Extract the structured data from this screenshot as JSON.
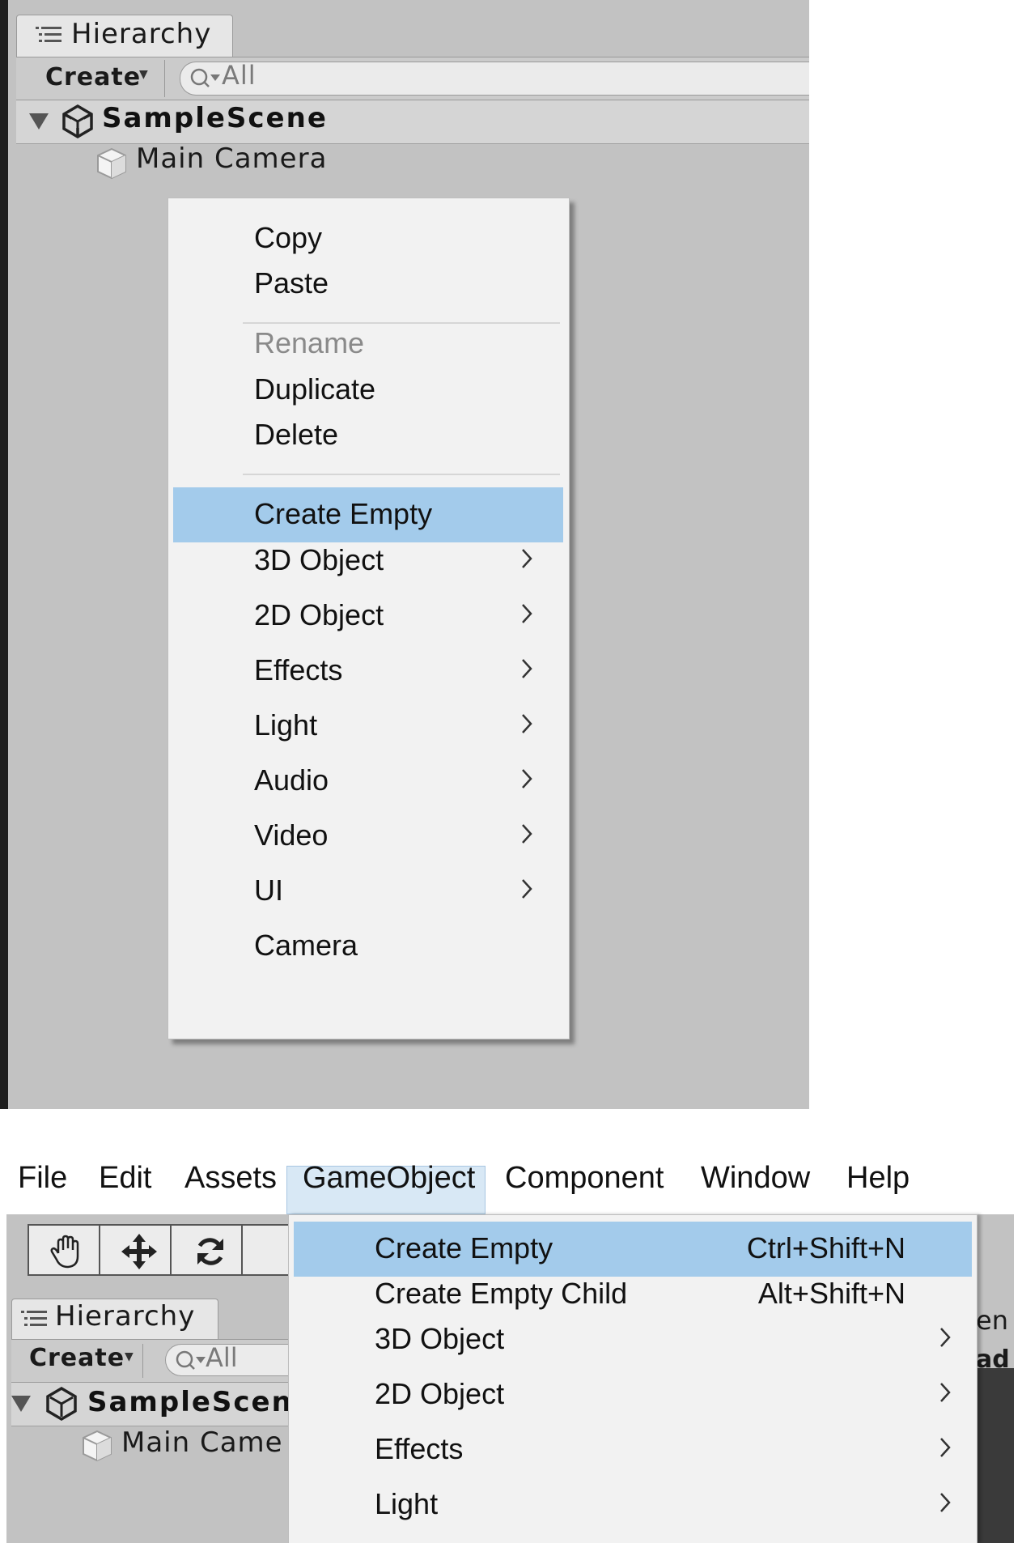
{
  "hierarchy_panel": {
    "tab_label": "Hierarchy",
    "create_label": "Create",
    "search_text": "All",
    "scene_name": "SampleScene",
    "camera_name": "Main Camera"
  },
  "context_menu": {
    "items": [
      {
        "label": "Copy"
      },
      {
        "label": "Paste"
      },
      {
        "label": "Rename",
        "disabled": true
      },
      {
        "label": "Duplicate"
      },
      {
        "label": "Delete"
      },
      {
        "label": "Create Empty",
        "highlighted": true
      },
      {
        "label": "3D Object",
        "submenu": true
      },
      {
        "label": "2D Object",
        "submenu": true
      },
      {
        "label": "Effects",
        "submenu": true
      },
      {
        "label": "Light",
        "submenu": true
      },
      {
        "label": "Audio",
        "submenu": true
      },
      {
        "label": "Video",
        "submenu": true
      },
      {
        "label": "UI",
        "submenu": true
      },
      {
        "label": "Camera"
      }
    ]
  },
  "menubar": {
    "items": [
      "File",
      "Edit",
      "Assets",
      "GameObject",
      "Component",
      "Window",
      "Help"
    ],
    "active": "GameObject"
  },
  "bottom_hierarchy": {
    "tab_label": "Hierarchy",
    "create_label": "Create",
    "search_text": "All",
    "scene_name": "SampleScen",
    "camera_name": "Main Came"
  },
  "right_partial": {
    "text_1": "en",
    "text_2": "ad"
  },
  "gameobject_menu": {
    "items": [
      {
        "label": "Create Empty",
        "shortcut": "Ctrl+Shift+N",
        "highlighted": true
      },
      {
        "label": "Create Empty Child",
        "shortcut": "Alt+Shift+N"
      },
      {
        "label": "3D Object",
        "submenu": true
      },
      {
        "label": "2D Object",
        "submenu": true
      },
      {
        "label": "Effects",
        "submenu": true
      },
      {
        "label": "Light",
        "submenu": true
      }
    ]
  },
  "colors": {
    "highlight": "#a3cbeb",
    "panel_bg": "#c2c2c2",
    "menu_bg": "#f2f2f2"
  }
}
